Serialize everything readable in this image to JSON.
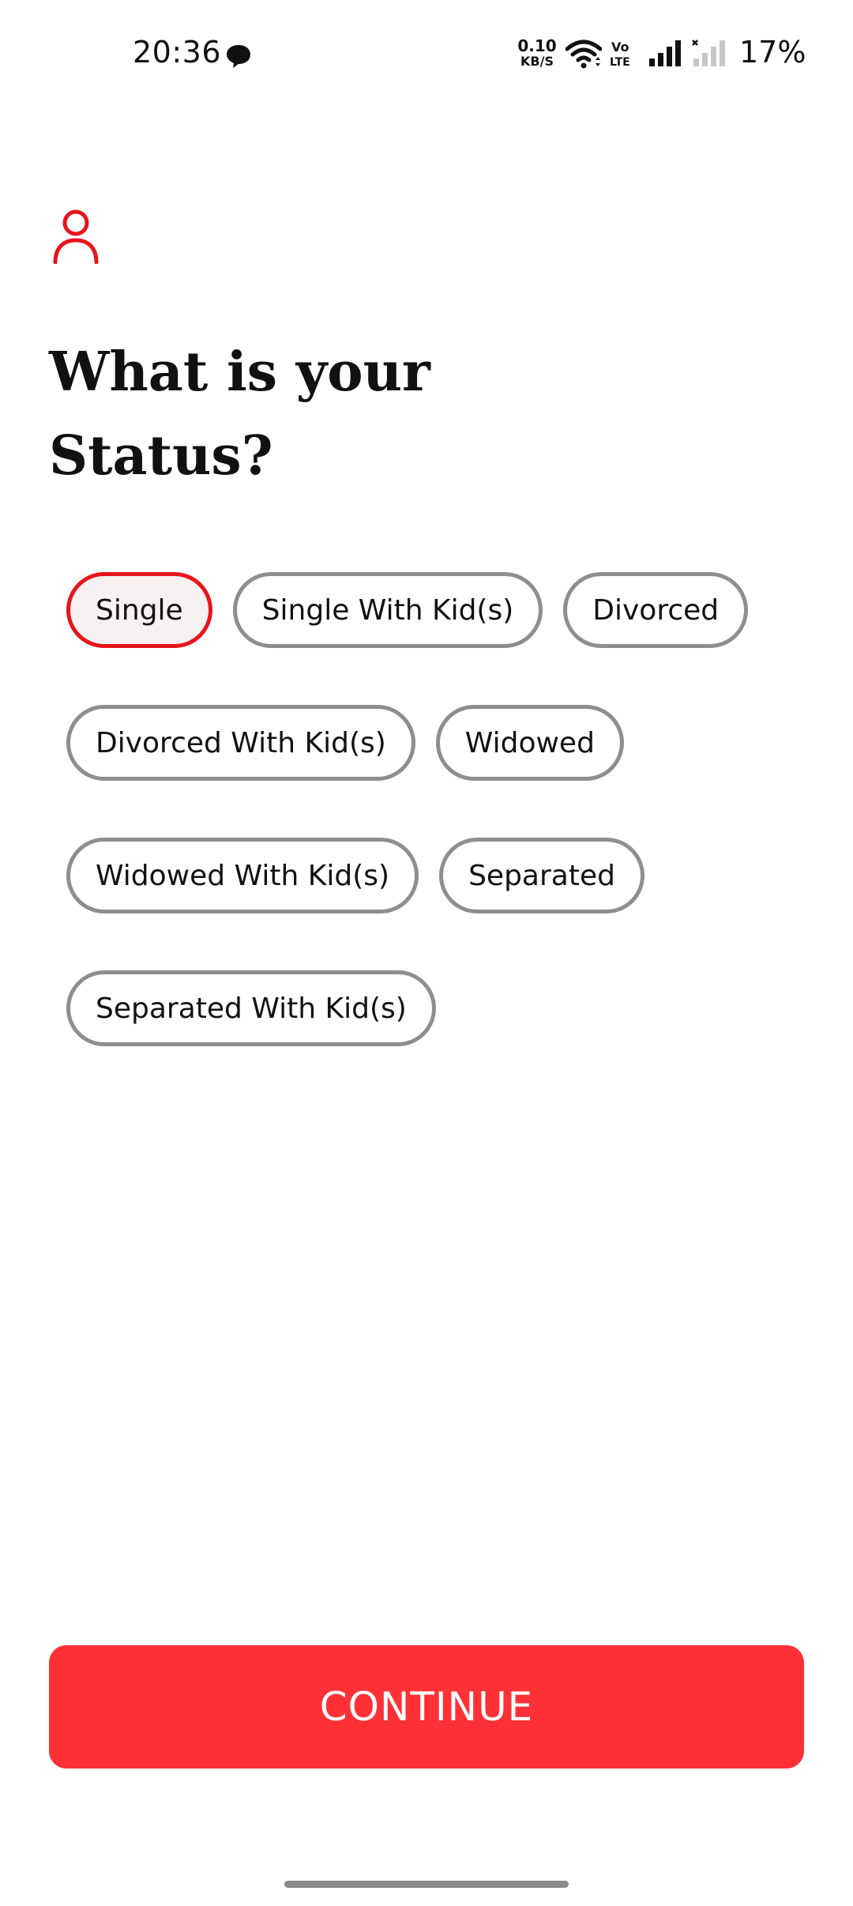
{
  "status_bar": {
    "time": "20:36",
    "net_speed_value": "0.10",
    "net_speed_unit": "KB/S",
    "battery": "17%",
    "icons": [
      "chat-bubble-icon",
      "wifi-icon",
      "volte-icon",
      "signal-icon",
      "signal-no-service-icon"
    ]
  },
  "header": {
    "icon": "user-profile-icon",
    "title_line1": "What is your",
    "title_line2": "Status?"
  },
  "options": {
    "selected": "Single",
    "rows": [
      [
        "Single",
        "Single With Kid(s)",
        "Divorced"
      ],
      [
        "Divorced With Kid(s)",
        "Widowed"
      ],
      [
        "Widowed With Kid(s)",
        "Separated"
      ],
      [
        "Separated With Kid(s)"
      ]
    ]
  },
  "actions": {
    "continue_label": "CONTINUE"
  },
  "colors": {
    "accent": "#ff3136",
    "selected_border": "#e8141b",
    "chip_border": "#8e8e8e",
    "icon_red": "#e8141b"
  }
}
